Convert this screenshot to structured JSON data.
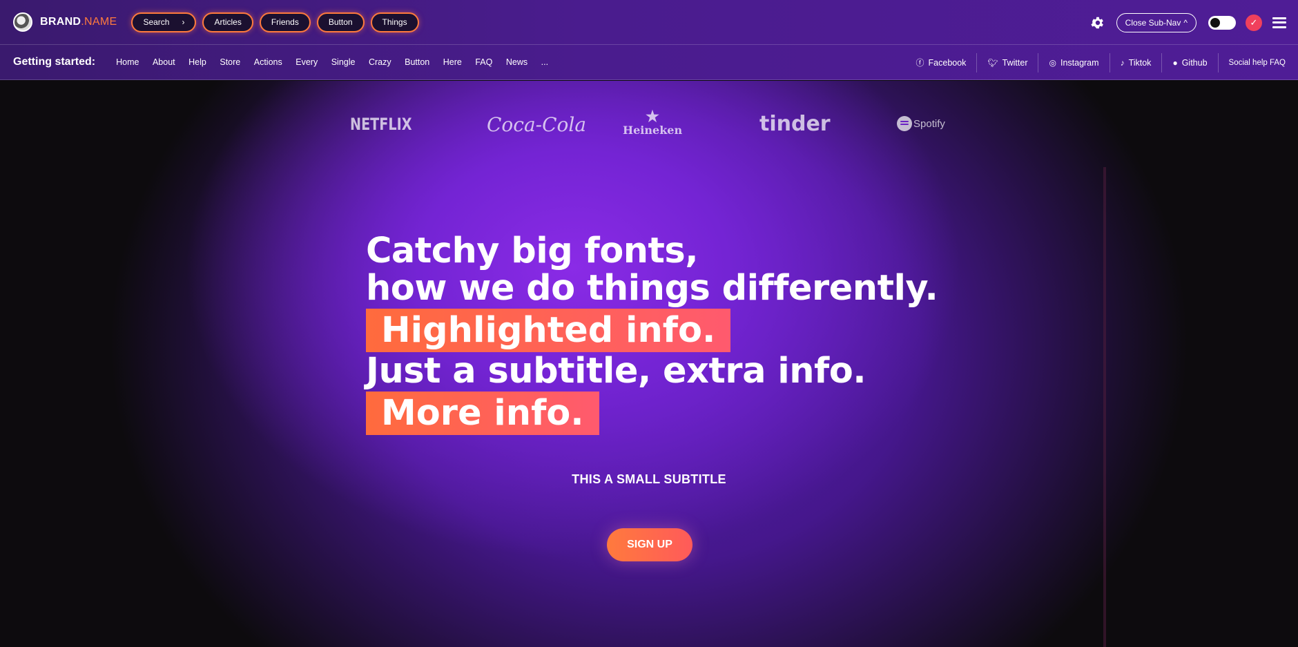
{
  "brand": {
    "part1": "BRAND",
    "part2": ".NAME"
  },
  "top_pills": [
    {
      "label": "Search"
    },
    {
      "label": "Articles"
    },
    {
      "label": "Friends"
    },
    {
      "label": "Button"
    },
    {
      "label": "Things"
    }
  ],
  "top_right": {
    "subnav_button": "Close Sub-Nav"
  },
  "subnav": {
    "title": "Getting started:",
    "links": [
      "Home",
      "About",
      "Help",
      "Store",
      "Actions",
      "Every",
      "Single",
      "Crazy",
      "Button",
      "Here",
      "FAQ",
      "News",
      "..."
    ],
    "social": [
      "Facebook",
      "Twitter",
      "Instagram",
      "Tiktok",
      "Github"
    ],
    "social_help": "Social help FAQ"
  },
  "logos": {
    "netflix": "NETFLIX",
    "cocacola": "Coca-Cola",
    "heineken": "Heineken",
    "tinder": "tinder",
    "spotify": "Spotify"
  },
  "hero": {
    "line1": "Catchy big fonts,",
    "line2": "how we do things differently.",
    "highlight1": "Highlighted info.",
    "line3": "Just a subtitle, extra info.",
    "highlight2": "More info.",
    "small_subtitle": "THIS A SMALL SUBTITLE",
    "cta": "SIGN UP"
  },
  "colors": {
    "accent": "#ff7a3d",
    "purple": "#7424d4",
    "check": "#f0405c"
  }
}
